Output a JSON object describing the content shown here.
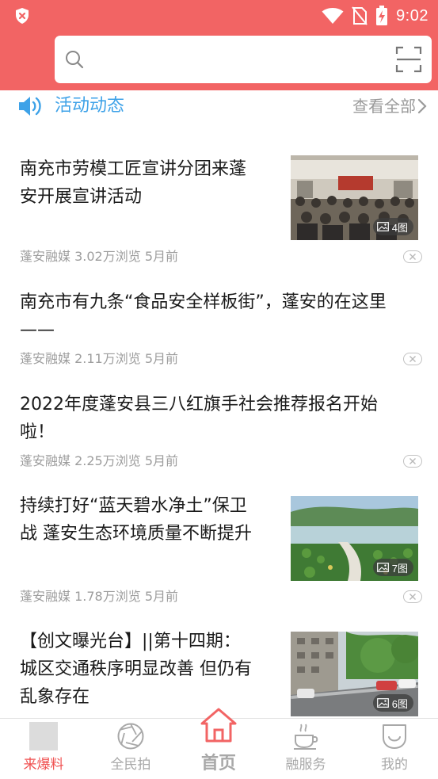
{
  "status_bar": {
    "time": "9:02"
  },
  "search": {
    "placeholder": ""
  },
  "section": {
    "title": "活动动态",
    "view_all": "查看全部"
  },
  "news": [
    {
      "title_line1": "南充市劳模工匠宣讲分团来蓬",
      "title_line2": "安开展宣讲活动",
      "source": "蓬安融媒",
      "views": "3.02万浏览",
      "time": "5月前",
      "image_count": "4图"
    },
    {
      "title_line1": "南充市有九条“食品安全样板街”，蓬安的在这里",
      "title_line2": "——",
      "source": "蓬安融媒",
      "views": "2.11万浏览",
      "time": "5月前"
    },
    {
      "title_line1": "2022年度蓬安县三八红旗手社会推荐报名开始",
      "title_line2": "啦！",
      "source": "蓬安融媒",
      "views": "2.25万浏览",
      "time": "5月前"
    },
    {
      "title_line1": "持续打好“蓝天碧水净土”保卫",
      "title_line2": "战 蓬安生态环境质量不断提升",
      "source": "蓬安融媒",
      "views": "1.78万浏览",
      "time": "5月前",
      "image_count": "7图"
    },
    {
      "title_line1": "【创文曝光台】||第十四期：",
      "title_line2": "城区交通秩序明显改善 但仍有",
      "title_line3": "乱象存在",
      "image_count": "6图"
    }
  ],
  "bottom_nav": [
    {
      "label": "来爆料",
      "active": true
    },
    {
      "label": "全民拍"
    },
    {
      "label": "首页"
    },
    {
      "label": "融服务"
    },
    {
      "label": "我的"
    }
  ],
  "colors": {
    "header": "#f26464",
    "accent_blue": "#3ea2e8",
    "nav_active": "#f05252",
    "nav_inactive": "#a8a8a8"
  }
}
